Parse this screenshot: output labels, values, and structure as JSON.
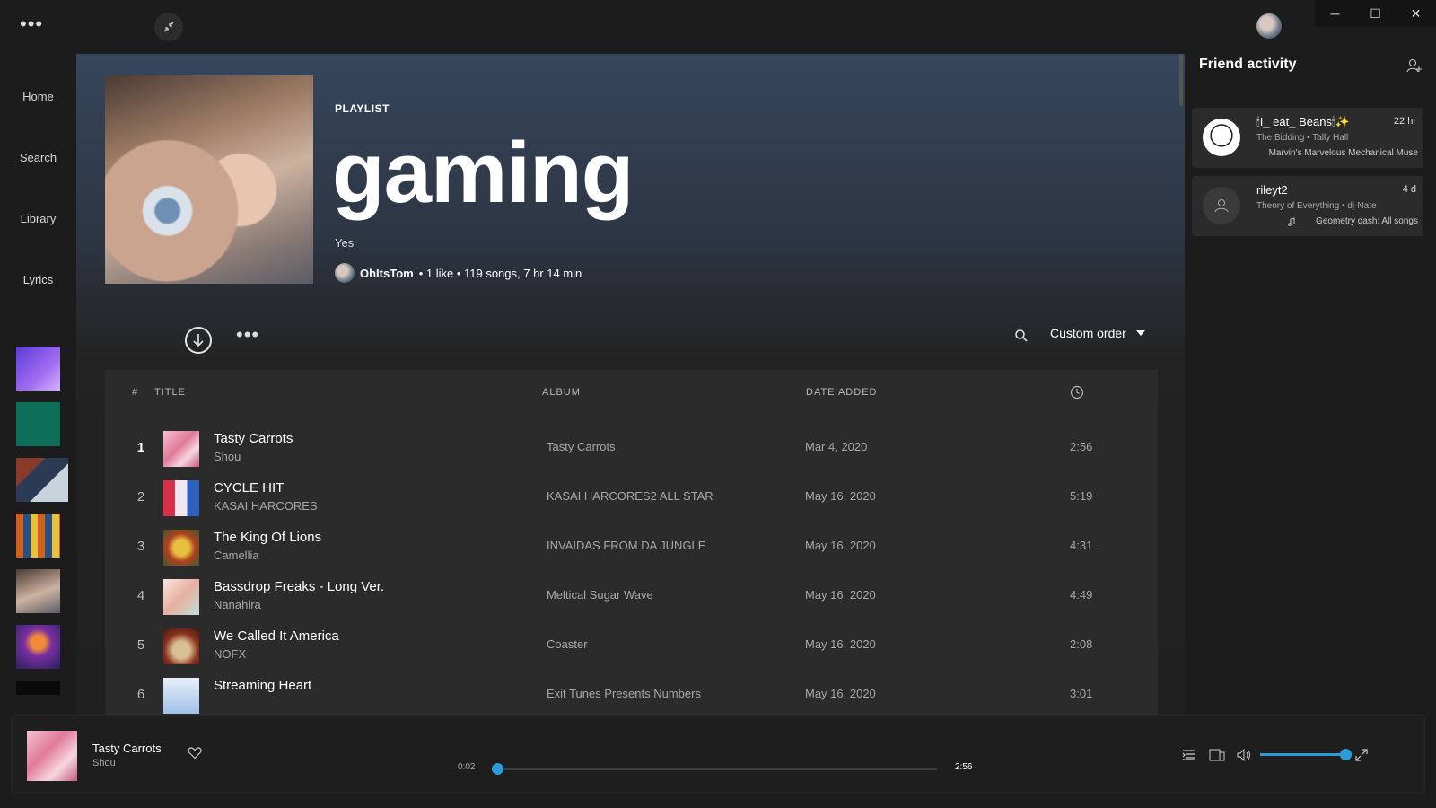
{
  "topbar": {
    "menu_label": "•••",
    "window_controls": {
      "minimize": "─",
      "maximize": "☐",
      "close": "✕"
    }
  },
  "sidebar": {
    "items": [
      {
        "label": "Home"
      },
      {
        "label": "Search"
      },
      {
        "label": "Library"
      },
      {
        "label": "Lyrics"
      }
    ]
  },
  "playlist": {
    "type_label": "PLAYLIST",
    "title": "gaming",
    "description": "Yes",
    "owner": "OhItsTom",
    "stats": "• 1 like • 119 songs, 7 hr 14 min",
    "more_label": "•••",
    "sort_label": "Custom order"
  },
  "tracklist": {
    "headers": {
      "num": "#",
      "title": "TITLE",
      "album": "ALBUM",
      "date": "DATE ADDED"
    },
    "rows": [
      {
        "num": "1",
        "title": "Tasty Carrots",
        "artist": "Shou",
        "album": "Tasty Carrots",
        "date": "Mar 4, 2020",
        "duration": "2:56"
      },
      {
        "num": "2",
        "title": "CYCLE HIT",
        "artist": "KASAI HARCORES",
        "album": "KASAI HARCORES2 ALL STAR",
        "date": "May 16, 2020",
        "duration": "5:19"
      },
      {
        "num": "3",
        "title": "The King Of Lions",
        "artist": "Camellia",
        "album": "INVAIDAS FROM DA JUNGLE",
        "date": "May 16, 2020",
        "duration": "4:31"
      },
      {
        "num": "4",
        "title": "Bassdrop Freaks - Long Ver.",
        "artist": "Nanahira",
        "album": "Meltical Sugar Wave",
        "date": "May 16, 2020",
        "duration": "4:49"
      },
      {
        "num": "5",
        "title": "We Called It America",
        "artist": "NOFX",
        "album": "Coaster",
        "date": "May 16, 2020",
        "duration": "2:08"
      },
      {
        "num": "6",
        "title": "Streaming Heart",
        "artist": "",
        "album": "Exit Tunes Presents Numbers",
        "date": "May 16, 2020",
        "duration": "3:01"
      }
    ]
  },
  "friend_activity": {
    "title": "Friend activity",
    "friends": [
      {
        "name": "🕯I_ eat_ Beans🕯✨",
        "time": "22 hr",
        "track": "The Bidding • Tally Hall",
        "context": "Marvin's Marvelous Mechanical Muse"
      },
      {
        "name": "rileyt2",
        "time": "4 d",
        "track": "Theory of Everything • dj-Nate",
        "context": "Geometry dash: All songs"
      }
    ]
  },
  "player": {
    "title": "Tasty Carrots",
    "artist": "Shou",
    "current_time": "0:02",
    "total_time": "2:56",
    "progress": 0.011,
    "volume": 1.0,
    "accent_color": "#2e9bd6"
  },
  "icons": [
    "menu-icon",
    "collapse-icon",
    "download-icon",
    "search-icon",
    "chevron-down-icon",
    "clock-icon",
    "add-friend-icon",
    "heart-icon",
    "queue-icon",
    "devices-icon",
    "volume-icon",
    "fullscreen-icon",
    "music-note-icon",
    "user-icon"
  ]
}
